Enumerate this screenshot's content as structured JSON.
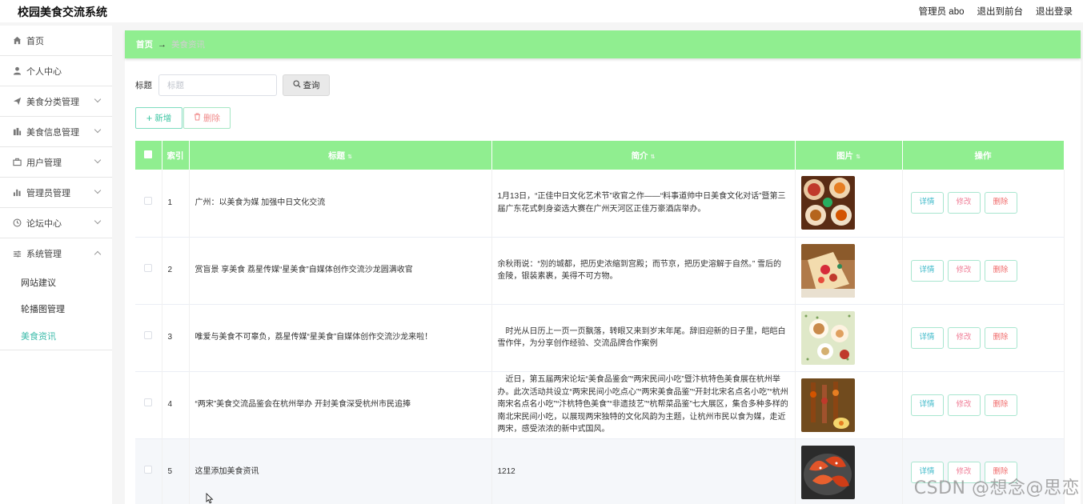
{
  "app": {
    "title": "校园美食交流系统",
    "admin_label": "管理员 abo",
    "to_front": "退出到前台",
    "logout": "退出登录"
  },
  "sidebar": {
    "items": [
      {
        "label": "首页",
        "icon": "home-icon",
        "has_children": false
      },
      {
        "label": "个人中心",
        "icon": "user-icon",
        "has_children": false
      },
      {
        "label": "美食分类管理",
        "icon": "send-icon",
        "has_children": true
      },
      {
        "label": "美食信息管理",
        "icon": "chart-icon",
        "has_children": true
      },
      {
        "label": "用户管理",
        "icon": "briefcase-icon",
        "has_children": true
      },
      {
        "label": "管理员管理",
        "icon": "bar-chart-icon",
        "has_children": true
      },
      {
        "label": "论坛中心",
        "icon": "clock-icon",
        "has_children": true
      },
      {
        "label": "系统管理",
        "icon": "sliders-icon",
        "has_children": true,
        "expanded": true
      }
    ],
    "sub_items": [
      {
        "label": "网站建议",
        "active": false
      },
      {
        "label": "轮播图管理",
        "active": false
      },
      {
        "label": "美食资讯",
        "active": true
      }
    ]
  },
  "breadcrumb": {
    "home": "首页",
    "arrow": "→",
    "current": "美食资讯"
  },
  "search": {
    "label": "标题",
    "placeholder": "标题",
    "value": "",
    "button": "查询"
  },
  "actions": {
    "add": "新增",
    "delete": "删除"
  },
  "table": {
    "headers": [
      "",
      "索引",
      "标题",
      "简介",
      "图片",
      "操作"
    ],
    "sortable": [
      false,
      false,
      true,
      true,
      true,
      false
    ],
    "rows": [
      {
        "index": "1",
        "title": "广州：以美食为媒 加强中日文化交流",
        "intro": "1月13日，“正佳中日文化艺术节”收官之作——“料事道帅中日美食文化对话”暨第三届广东花式刺身姿选大赛在广州天河区正佳万豪酒店举办。",
        "image": "food-plates"
      },
      {
        "index": "2",
        "title": "赏盲景 享美食 荔星传媒“星美食”自媒体创作交流沙龙圆满收官",
        "intro": "余秋雨说：“別的城都，把历史浓缩到宫殿；而节京，把历史溶解于自然。” 雪后的金陵，银装素裹，美得不可方物。",
        "image": "crepe"
      },
      {
        "index": "3",
        "title": "唯爱与美食不可辜负，荔星传媒“星美食”自媒体创作交流沙龙来啦！",
        "intro": "　时光从日历上一页一页飘落，转眼又来到岁末年尾。辞旧迎新的日子里，皑皑白雪作伴，为分享创作经验、交流品牌合作案例",
        "image": "tea-table"
      },
      {
        "index": "4",
        "title": "“两宋”美食交流品鉴会在杭州举办 开封美食深受杭州市民追捧",
        "intro": "　近日，第五届两宋论坛“美食品鉴会”“两宋民间小吃”暨汴杭特色美食展在杭州举办。此次活动共设立“两宋民间小吃点心”“两宋美食品鉴”“开封北宋名点名小吃”“杭州南宋名点名小吃”“汴杭特色美食”“非遗技艺”“杭帮菜品鉴”七大展区，集合多种多样的南北宋民间小吃，以展现两宋独特的文化风韵为主题，让杭州市民以食为媒，走近两宋，感受浓浓的新中式国风。",
        "image": "skewers"
      },
      {
        "index": "5",
        "title": "这里添加美食资讯",
        "intro": "1212",
        "image": "shrimp"
      }
    ],
    "ops": {
      "detail": "详情",
      "edit": "修改",
      "delete": "删除"
    }
  },
  "watermark": "CSDN @想念@思恋",
  "colors": {
    "accent_green": "#90ee90",
    "active_teal": "#3bbbaa",
    "detail_btn": "#3bb8c8",
    "edit_btn": "#f0829a",
    "delete_btn": "#f06c6c"
  }
}
